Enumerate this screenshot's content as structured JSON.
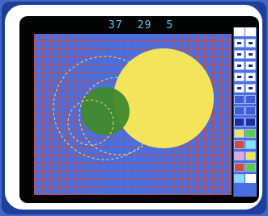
{
  "topbar": {
    "values": [
      "37",
      "29",
      "5"
    ]
  },
  "colors": {
    "canvas_blue": "#4a6fe0",
    "grid_red": "#d14532",
    "circle_yellow": "#f4e45a",
    "circle_green": "#3f8a2c",
    "text_cyan": "#5cc8e8"
  },
  "palette": {
    "tools": [
      "tool-slot",
      "tool-slot",
      "tool-slot",
      "tool-slot",
      "tool-slot",
      "tool-slot",
      "tool-slot",
      "tool-slot",
      "tool-slot",
      "tool-slot",
      "tool-slot",
      "tool-slot",
      "tool-slot",
      "tool-slot",
      "tool-slot",
      "tool-slot",
      "tool-slot",
      "tool-slot",
      "tool-slot",
      "tool-slot",
      "tool-slot",
      "tool-slot",
      "tool-slot",
      "tool-slot",
      "tool-slot",
      "tool-slot",
      "tool-slot",
      "tool-slot"
    ]
  }
}
